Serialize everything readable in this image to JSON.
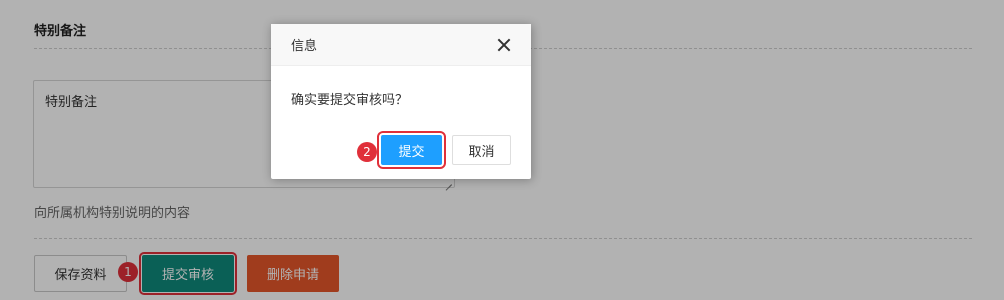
{
  "section": {
    "title": "特别备注"
  },
  "remarks": {
    "placeholder": "特别备注",
    "hint": "向所属机构特别说明的内容"
  },
  "actions": {
    "save_label": "保存资料",
    "submit_label": "提交审核",
    "delete_label": "删除申请"
  },
  "dialog": {
    "title": "信息",
    "message": "确实要提交审核吗？",
    "ok_label": "提交",
    "cancel_label": "取消"
  },
  "annotations": {
    "step1": "1",
    "step2": "2"
  },
  "colors": {
    "submit": "#0f8a7b",
    "delete": "#e6562a",
    "ok": "#1e9fff",
    "highlight": "#e0303a"
  }
}
